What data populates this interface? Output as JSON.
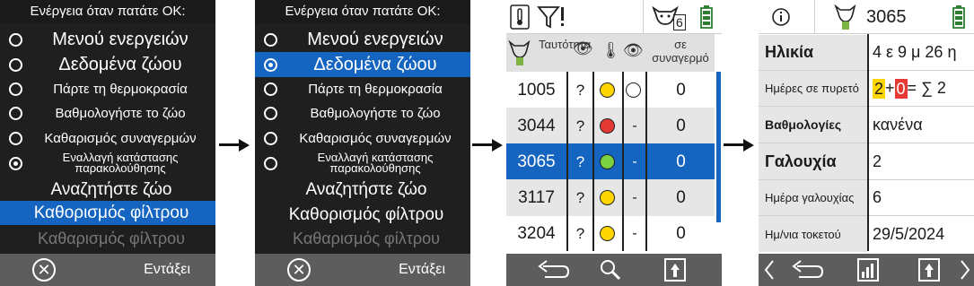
{
  "menu_title": "Ενέργεια όταν πατάτε OK:",
  "menu_items": [
    "Μενού ενεργειών",
    "Δεδομένα ζώου",
    "Πάρτε τη θερμοκρασία",
    "Βαθμολογήστε το ζώο",
    "Καθαρισμός συναγερμών",
    "Εναλλαγή κατάστασης παρακολούθησης",
    "Αναζητήστε ζώο",
    "Καθορισμός φίλτρου",
    "Καθαρισμός φίλτρου"
  ],
  "screen1": {
    "checked_index": 5,
    "highlighted_index": 7
  },
  "screen2": {
    "checked_index": 1,
    "highlighted_index": 1
  },
  "footer": {
    "ok_label": "Εντάξει"
  },
  "list_screen": {
    "herd_count": "6",
    "columns": {
      "id": "Ταυτότητα",
      "alarms": "σε συναγερμό"
    },
    "rows": [
      {
        "id": "1005",
        "q": "?",
        "status_color": "yellow",
        "watch": "empty-circle",
        "alarms": "0"
      },
      {
        "id": "3044",
        "q": "?",
        "status_color": "red",
        "watch": "-",
        "alarms": "0"
      },
      {
        "id": "3065",
        "q": "?",
        "status_color": "green",
        "watch": "-",
        "alarms": "0"
      },
      {
        "id": "3117",
        "q": "?",
        "status_color": "yellow",
        "watch": "-",
        "alarms": "0"
      },
      {
        "id": "3204",
        "q": "?",
        "status_color": "yellow",
        "watch": "-",
        "alarms": "0"
      }
    ],
    "selected_row": 2
  },
  "detail_screen": {
    "animal_id": "3065",
    "rows": {
      "age_label": "Ηλικία",
      "age_value": "4 ε 9 μ 26 η",
      "fever_label": "Ημέρες σε πυρετό",
      "fever_a": "2",
      "fever_plus": "+",
      "fever_b": "0",
      "fever_sum": "= ∑ 2",
      "score_label": "Βαθμολογίες",
      "score_value": "κανένα",
      "lact_label": "Γαλουχία",
      "lact_value": "2",
      "lact_day_label": "Ημέρα γαλουχίας",
      "lact_day_value": "6",
      "calving_label": "Ημ/νια τοκετού",
      "calving_value": "29/5/2024"
    }
  },
  "colors": {
    "accent": "#1565c0",
    "yellow": "#ffd600",
    "red": "#e53935",
    "green": "#7cd142",
    "fever_a_bg": "#ffd600",
    "fever_b_bg": "#e53935",
    "bar": "#5d5d5d"
  }
}
